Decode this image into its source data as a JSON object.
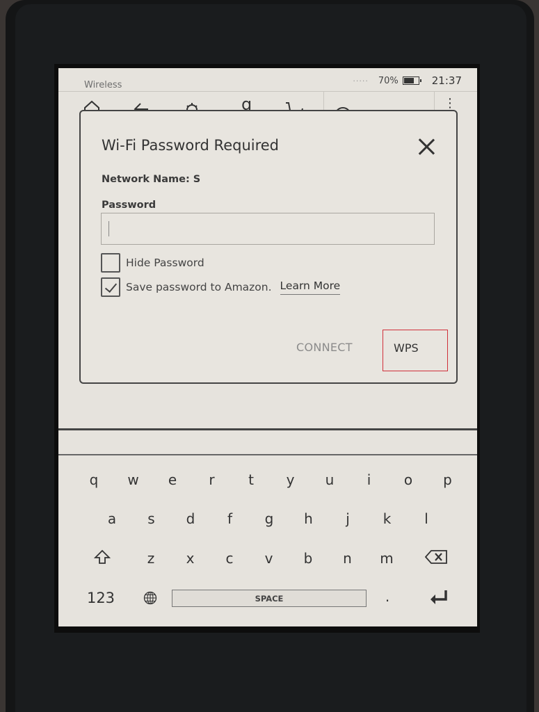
{
  "status_bar": {
    "title": "Wireless",
    "battery_percent_label": "70%",
    "battery_level": 0.7,
    "time": "21:37"
  },
  "toolbar": {
    "icons": [
      "home-icon",
      "back-icon",
      "settings-icon",
      "goodreads-icon",
      "store-icon",
      "search-icon",
      "menu-icon"
    ]
  },
  "dialog": {
    "title": "Wi-Fi Password Required",
    "network_name_label": "Network Name: S",
    "password_label": "Password",
    "password_value": "",
    "hide_password_label": "Hide Password",
    "hide_password_checked": false,
    "save_password_label": "Save password to Amazon.",
    "save_password_checked": true,
    "learn_more_label": "Learn More",
    "connect_label": "CONNECT",
    "wps_label": "WPS",
    "highlight_color": "#d0303a"
  },
  "keyboard": {
    "row1": [
      "q",
      "w",
      "e",
      "r",
      "t",
      "y",
      "u",
      "i",
      "o",
      "p"
    ],
    "row2": [
      "a",
      "s",
      "d",
      "f",
      "g",
      "h",
      "j",
      "k",
      "l"
    ],
    "row3": [
      "z",
      "x",
      "c",
      "v",
      "b",
      "n",
      "m"
    ],
    "numbers_label": "123",
    "space_label": "SPACE",
    "period_label": ".",
    "shift_icon": "shift-icon",
    "backspace_icon": "backspace-icon",
    "globe_icon": "globe-icon",
    "enter_icon": "enter-icon"
  }
}
